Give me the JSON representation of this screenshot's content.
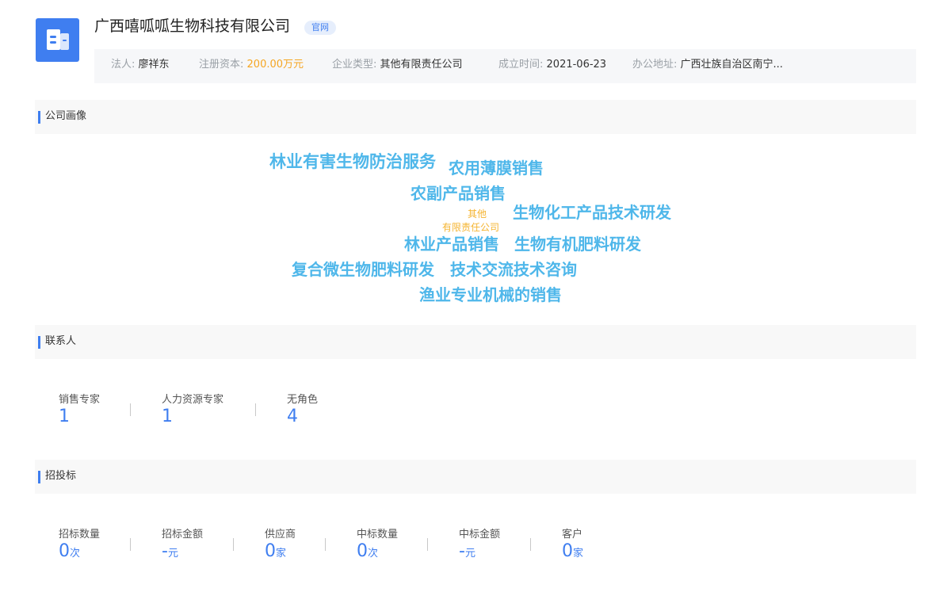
{
  "company": {
    "name": "广西嘻呱呱生物科技有限公司",
    "badge": "官网"
  },
  "info": {
    "legal_rep_label": "法人:",
    "legal_rep_value": "廖祥东",
    "capital_label": "注册资本:",
    "capital_value": "200.00万元",
    "type_label": "企业类型:",
    "type_value": "其他有限责任公司",
    "date_label": "成立时间:",
    "date_value": "2021-06-23",
    "address_label": "办公地址:",
    "address_value": "广西壮族自治区南宁..."
  },
  "portrait": {
    "title": "公司画像",
    "words": [
      "林业有害生物防治服务",
      "农用薄膜销售",
      "农副产品销售",
      "其他",
      "有限责任公司",
      "生物化工产品技术研发",
      "林业产品销售",
      "生物有机肥料研发",
      "复合微生物肥料研发",
      "技术交流技术咨询",
      "渔业专业机械的销售"
    ]
  },
  "contacts": {
    "title": "联系人",
    "items": [
      {
        "label": "销售专家",
        "value": "1"
      },
      {
        "label": "人力资源专家",
        "value": "1"
      },
      {
        "label": "无角色",
        "value": "4"
      }
    ]
  },
  "bidding": {
    "title": "招投标",
    "items": [
      {
        "label": "招标数量",
        "value": "0",
        "unit": "次"
      },
      {
        "label": "招标金额",
        "value": "-",
        "unit": "元"
      },
      {
        "label": "供应商",
        "value": "0",
        "unit": "家"
      },
      {
        "label": "中标数量",
        "value": "0",
        "unit": "次"
      },
      {
        "label": "中标金额",
        "value": "-",
        "unit": "元"
      },
      {
        "label": "客户",
        "value": "0",
        "unit": "家"
      }
    ]
  },
  "colors": {
    "accent": "#3f7ef0",
    "cloud_blue": "#4fb7ea",
    "cloud_orange": "#f5b431",
    "capital_orange": "#f5a623"
  },
  "icons": [
    "building-icon"
  ]
}
